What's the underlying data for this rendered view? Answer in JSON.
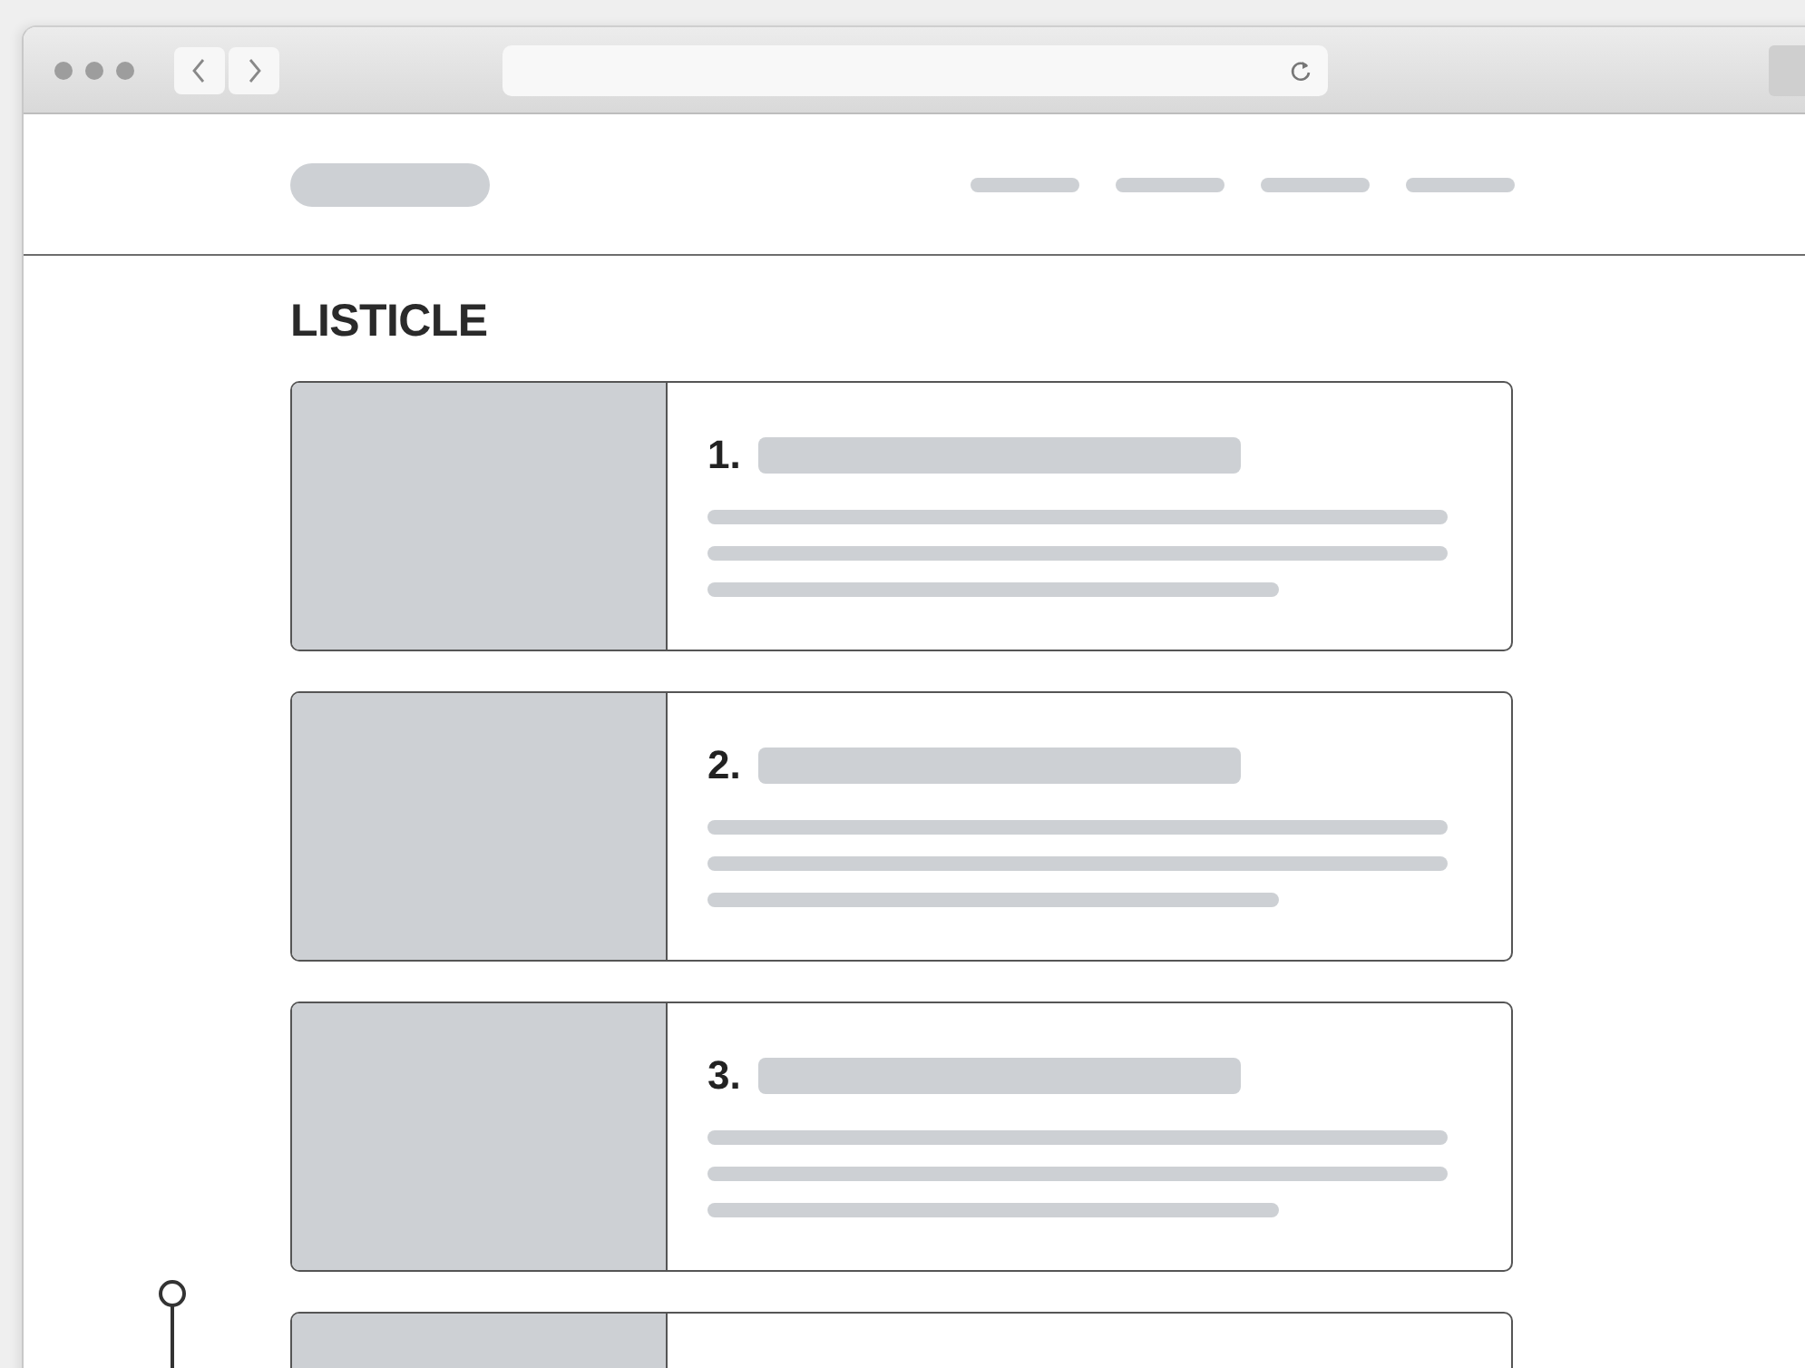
{
  "page": {
    "heading": "LISTICLE"
  },
  "items": [
    {
      "number": "1."
    },
    {
      "number": "2."
    },
    {
      "number": "3."
    }
  ],
  "partial_item": true
}
